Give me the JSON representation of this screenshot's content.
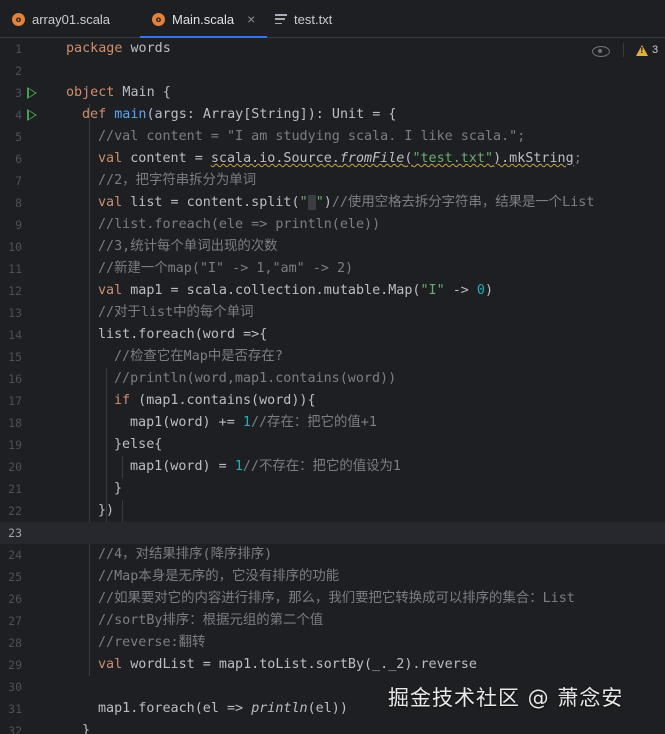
{
  "tabs": [
    {
      "label": "array01.scala",
      "icon": "scala-file-icon",
      "active": false
    },
    {
      "label": "Main.scala",
      "icon": "scala-file-icon",
      "active": true
    },
    {
      "label": "test.txt",
      "icon": "text-file-icon",
      "active": false
    }
  ],
  "tab_close_glyph": "×",
  "inspections": {
    "warning_count": "3",
    "warning_icon": "warning-icon",
    "reader_mode_icon": "eye-icon"
  },
  "gutter": {
    "current_line": 23,
    "run_lines": [
      3,
      4
    ]
  },
  "lines": {
    "l1_kw": "package",
    "l1_name": " words",
    "l3_kw": "object",
    "l3_name": " Main ",
    "l3_brace": "{",
    "l4_kw": "def",
    "l4_fn": "main",
    "l4_rest": "(args: Array[String]): Unit = {",
    "l5": "//val content = \"I am studying scala. I like scala.\";",
    "l6_kw": "val",
    "l6_a": " content = ",
    "l6_b": "scala.io.Source.",
    "l6_c": "fromFile",
    "l6_d": "(",
    "l6_s": "\"test.txt\"",
    "l6_e": ").mkString",
    "l6_f": ";",
    "l7": "//2，把字符串拆分为单词",
    "l8_kw": "val",
    "l8_a": " list = content.split(",
    "l8_s1": "\"",
    "l8_s2": " ",
    "l8_s3": "\"",
    "l8_b": ")",
    "l8_c": "//使用空格去拆分字符串，结果是一个List",
    "l9": "//list.foreach(ele => println(ele))",
    "l10": "//3,统计每个单词出现的次数",
    "l11": "//新建一个map(\"I\" -> 1,\"am\" -> 2)",
    "l12_kw": "val",
    "l12_a": " map1 = scala.collection.mutable.Map(",
    "l12_s": "\"I\"",
    "l12_b": " -> ",
    "l12_n": "0",
    "l12_c": ")",
    "l13": "//对于list中的每个单词",
    "l14": "list.foreach(word =>{",
    "l15": "//检查它在Map中是否存在?",
    "l16": "//println(word,map1.contains(word))",
    "l17_kw": "if",
    "l17_a": " (map1.contains(word)){",
    "l18_a": "map1(word) += ",
    "l18_n": "1",
    "l18_c": "//存在：把它的值+1",
    "l19": "}else{",
    "l20_a": "map1(word) = ",
    "l20_n": "1",
    "l20_c": "//不存在：把它的值设为1",
    "l21": "}",
    "l22": "})",
    "l23": "",
    "l24": "//4，对结果排序(降序排序)",
    "l25": "//Map本身是无序的，它没有排序的功能",
    "l26": "//如果要对它的内容进行排序，那么，我们要把它转换成可以排序的集合：List",
    "l27": "//sortBy排序：根据元组的第二个值",
    "l28": "//reverse:翻转",
    "l29_kw": "val",
    "l29_a": " wordList = map1.toList.sortBy(_._2).reverse",
    "l30": "",
    "l31_a": "map1.foreach(el => ",
    "l31_b": "println",
    "l31_c": "(el))",
    "l32": "}"
  },
  "watermark": "掘金技术社区 @ 萧念安"
}
